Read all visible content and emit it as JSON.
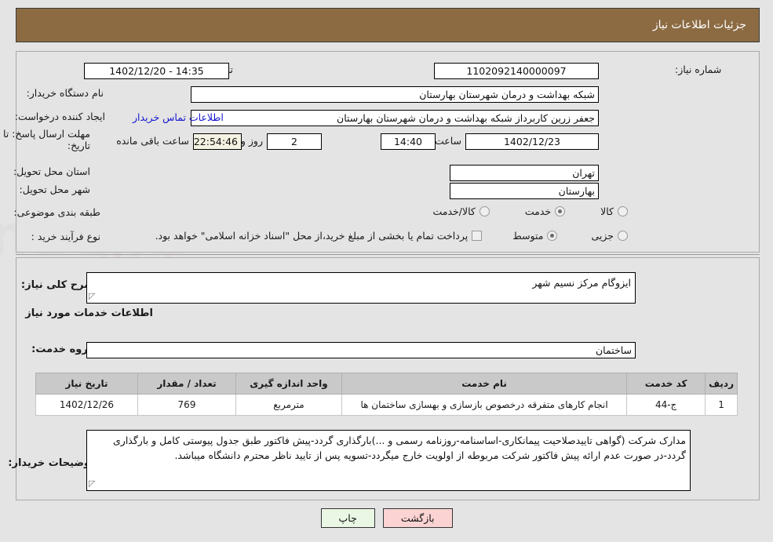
{
  "header": {
    "title": "جزئیات اطلاعات نیاز"
  },
  "form": {
    "need_number_label": "شماره نیاز:",
    "need_number_value": "1102092140000097",
    "announce_label": "تاریخ و ساعت اعلان عمومی:",
    "announce_value": "14:35 - 1402/12/20",
    "buyer_org_label": "نام دستگاه خریدار:",
    "buyer_org_value": "شبکه بهداشت و درمان شهرستان بهارستان",
    "requester_label": "ایجاد کننده درخواست:",
    "requester_value": "جعفر زرین کاربرداز شبکه بهداشت و درمان شهرستان بهارستان",
    "contact_link": "اطلاعات تماس خریدار",
    "deadline_label": "مهلت ارسال پاسخ: تا تاریخ:",
    "deadline_date": "1402/12/23",
    "hour_label": "ساعت",
    "deadline_time": "14:40",
    "days_value": "2",
    "days_label": "روز و",
    "countdown_value": "22:54:46",
    "countdown_label": "ساعت باقی مانده",
    "province_label": "استان محل تحویل:",
    "province_value": "تهران",
    "city_label": "شهر محل تحویل:",
    "city_value": "بهارستان",
    "category_label": "طبقه بندی موضوعی:",
    "category_options": [
      {
        "label": "کالا",
        "selected": false
      },
      {
        "label": "خدمت",
        "selected": true
      },
      {
        "label": "کالا/خدمت",
        "selected": false
      }
    ],
    "process_label": "نوع فرآیند خرید :",
    "process_options": [
      {
        "label": "جزیی",
        "selected": false
      },
      {
        "label": "متوسط",
        "selected": true
      }
    ],
    "treasury_checkbox_label": "پرداخت تمام یا بخشی از مبلغ خرید،از محل \"اسناد خزانه اسلامی\" خواهد بود.",
    "treasury_checked": false
  },
  "details": {
    "summary_label": "شرح کلی نیاز:",
    "summary_value": "ایزوگام مرکز نسیم شهر",
    "section_title": "اطلاعات خدمات مورد نیاز",
    "service_group_label": "گروه خدمت:",
    "service_group_value": "ساختمان",
    "notes_label": "توضیحات خریدار:",
    "notes_value": "مدارک شرکت (گواهی تاییدصلاحیت پیمانکاری-اساسنامه-روزنامه رسمی و ...)بارگذاری گردد-پیش فاکتور طبق جدول پیوستی کامل و بارگذاری گردد-در صورت عدم ارائه پیش فاکتور شرکت مربوطه از اولویت خارج میگردد-تسویه پس از تایید ناظر محترم دانشگاه میباشد."
  },
  "table": {
    "columns": [
      "ردیف",
      "کد خدمت",
      "نام خدمت",
      "واحد اندازه گیری",
      "تعداد / مقدار",
      "تاریخ نیاز"
    ],
    "rows": [
      {
        "row_no": "1",
        "code": "ج-44",
        "name": "انجام کارهای متفرقه درخصوص بازسازی و بهسازی ساختمان ها",
        "unit": "مترمربع",
        "qty": "769",
        "date": "1402/12/26"
      }
    ]
  },
  "buttons": {
    "back": "بازگشت",
    "print": "چاپ"
  },
  "colors": {
    "header_bg": "#8c6b43",
    "link": "#1414d2",
    "back_btn": "#fbd3d3",
    "print_btn": "#e9f7e4",
    "table_header": "#c9c9c9"
  }
}
